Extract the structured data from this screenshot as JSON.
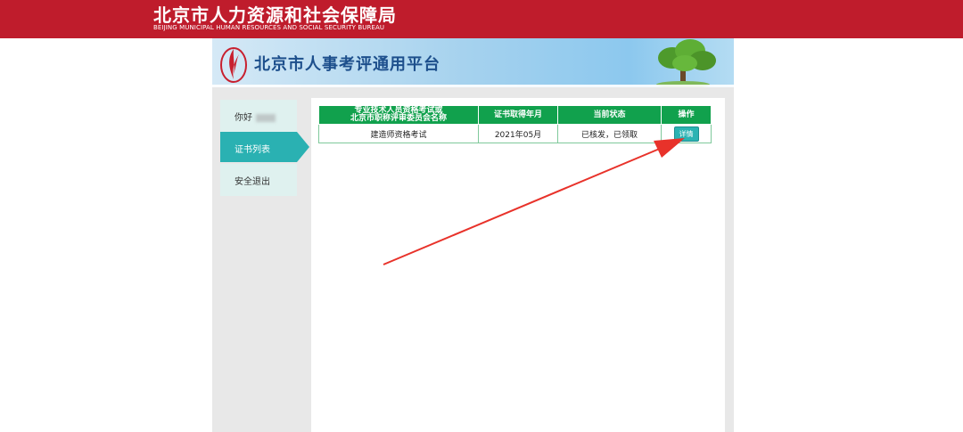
{
  "header": {
    "bureau_cn": "北京市人力资源和社会保障局",
    "bureau_en": "BEIJING MUNICIPAL HUMAN RESOURCES AND SOCIAL SECURITY BUREAU"
  },
  "banner": {
    "platform_title": "北京市人事考评通用平台"
  },
  "sidebar": {
    "greeting": "你好",
    "items": [
      {
        "label": "证书列表",
        "active": true
      },
      {
        "label": "安全退出",
        "active": false
      }
    ]
  },
  "table": {
    "headers": {
      "name_line1": "专业技术人员资格考试或",
      "name_line2": "北京市职称评审委员会名称",
      "date": "证书取得年月",
      "status": "当前状态",
      "action": "操作"
    },
    "rows": [
      {
        "name": "建造师资格考试",
        "date": "2021年05月",
        "status": "已核发，已领取",
        "action": "详情"
      }
    ]
  },
  "colors": {
    "top_bar": "#bf1c2c",
    "table_header": "#11a14d",
    "sidebar_active": "#2ab1b2",
    "annotation_arrow": "#e8322a"
  }
}
